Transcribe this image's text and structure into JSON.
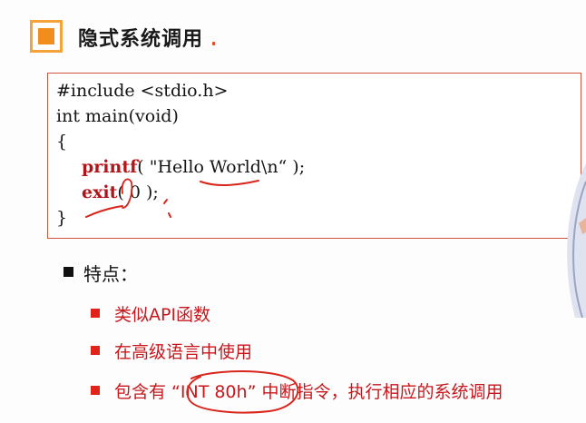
{
  "title": {
    "text": "隐式系统调用",
    "icon": "orange-square-bullet-icon"
  },
  "code": {
    "line1": "#include <stdio.h>",
    "line2": "int main(void)",
    "line3": "{",
    "line4_fn": "printf",
    "line4_rest": "( \"Hello World\\n“ );",
    "line5_fn": "exit",
    "line5_rest": "( 0 );",
    "line6": "}"
  },
  "features": {
    "heading": "特点：",
    "items": [
      "类似API函数",
      "在高级语言中使用",
      "包含有 “INT 80h” 中断指令，执行相应的系统调用"
    ]
  },
  "colors": {
    "accent_orange": "#f28c1b",
    "code_border": "#d2533f",
    "highlight_red": "#c8171c",
    "bullet_red": "#e2231a"
  }
}
